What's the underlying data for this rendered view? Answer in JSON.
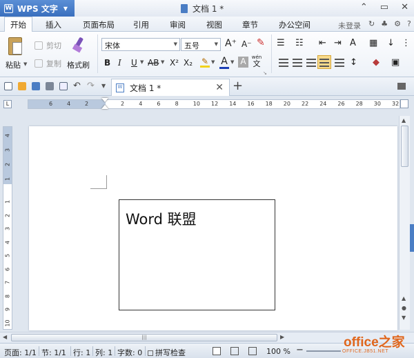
{
  "window": {
    "app_menu_label": "WPS 文字",
    "doc_title": "文档 1 *",
    "minimize": "⌃",
    "restore": "▭",
    "close": "✕"
  },
  "menu": {
    "tabs": [
      "开始",
      "插入",
      "页面布局",
      "引用",
      "审阅",
      "视图",
      "章节",
      "办公空间"
    ],
    "login": "未登录",
    "help": "?"
  },
  "ribbon": {
    "paste": "粘贴",
    "cut": "剪切",
    "copy": "复制",
    "format_painter": "格式刷",
    "font_name": "宋体",
    "font_size": "五号",
    "grow_font": "A⁺",
    "shrink_font": "A⁻",
    "bold": "B",
    "italic": "I",
    "underline": "U",
    "strike": "AB",
    "superscript": "X²",
    "subscript": "X₂",
    "font_color_label": "A",
    "phonetic_label": "wén",
    "phonetic_char": "文"
  },
  "tabs_row": {
    "doc_tab_label": "文档 1 *",
    "new_tab": "+"
  },
  "ruler": {
    "h_left_numbers": [
      "6",
      "4",
      "2"
    ],
    "h_right_numbers": [
      "2",
      "4",
      "6",
      "8",
      "10",
      "12",
      "14",
      "16",
      "18",
      "20",
      "22",
      "24",
      "26",
      "28",
      "30",
      "32"
    ],
    "v_top_numbers": [
      "4",
      "3",
      "2",
      "1"
    ],
    "v_body_numbers": [
      "1",
      "2",
      "3",
      "4",
      "5",
      "6",
      "7",
      "8",
      "9",
      "10"
    ],
    "corner_label": "L"
  },
  "document": {
    "textbox_text": "Word 联盟"
  },
  "status": {
    "page": "页面: 1/1",
    "section": "节: 1/1",
    "line": "行: 1",
    "column": "列: 1",
    "words": "字数: 0",
    "spell_check": "拼写检查",
    "zoom": "100 %",
    "zoom_out": "−"
  },
  "watermark": {
    "brand": "office之家",
    "site": "OFFICE.JB51.NET"
  },
  "colors": {
    "accent": "#3a6fbe",
    "highlight": "#f2d21b",
    "font_color": "#1c3fb5",
    "watermark": "#e0661c"
  }
}
